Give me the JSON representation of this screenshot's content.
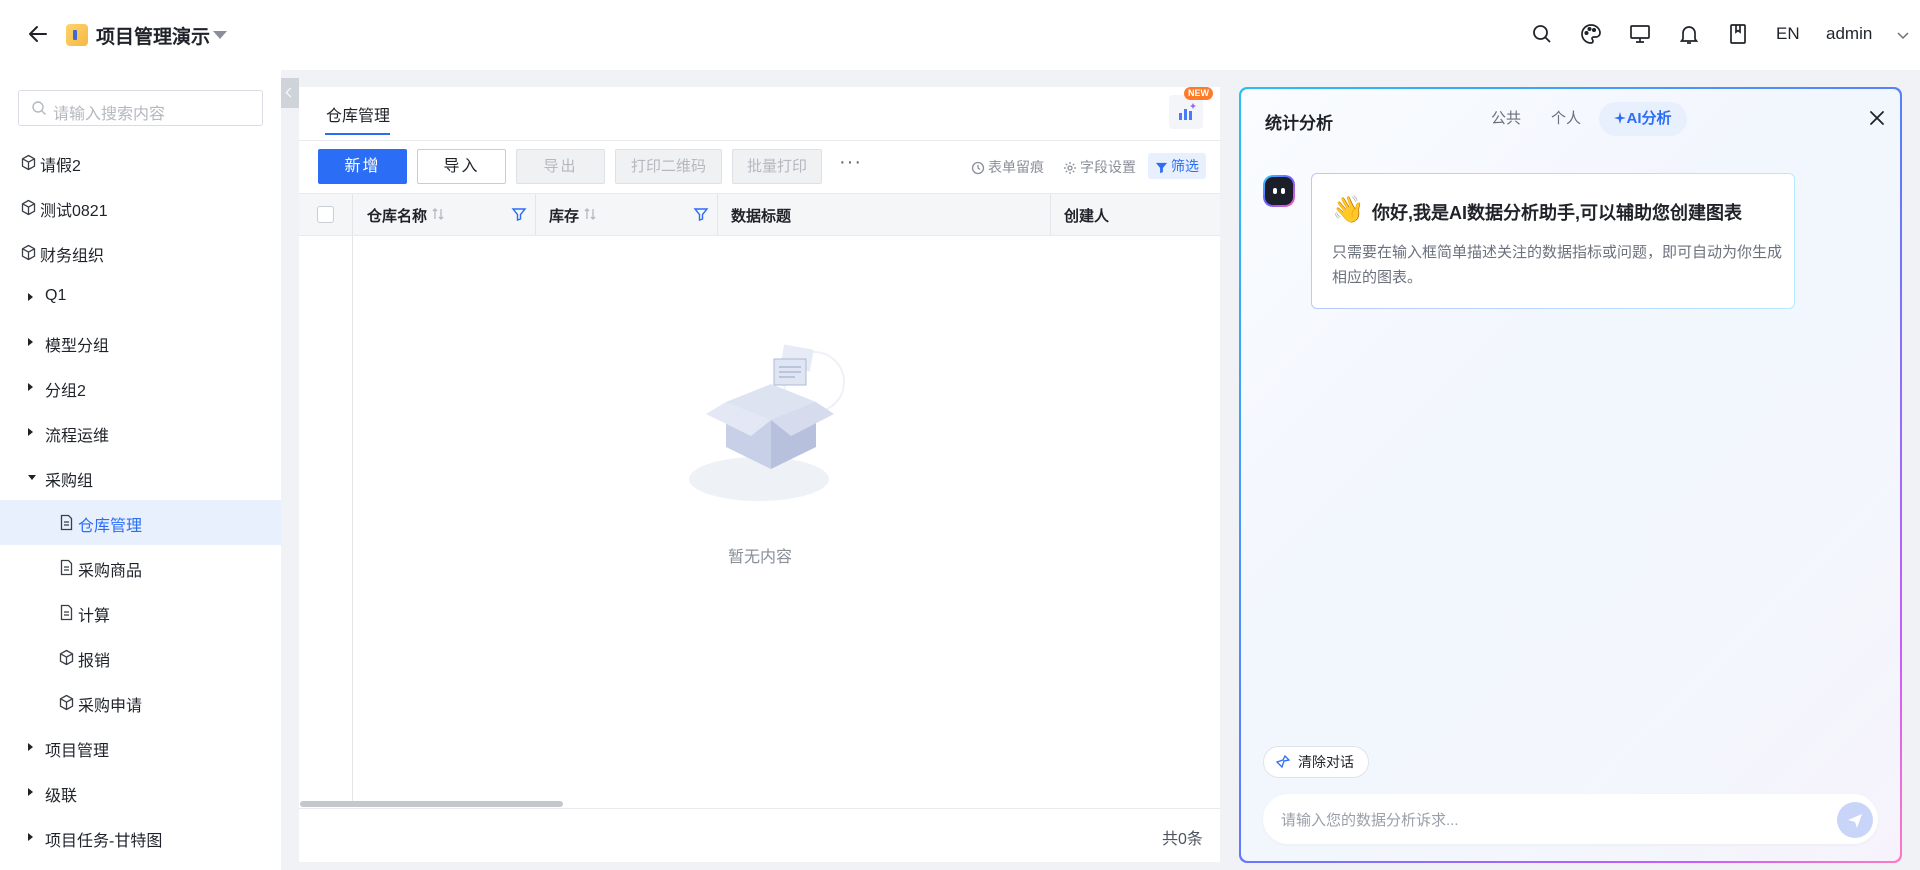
{
  "header": {
    "app_title": "项目管理演示",
    "lang": "EN",
    "user": "admin"
  },
  "sidebar": {
    "search_placeholder": "请输入搜索内容",
    "items": [
      {
        "label": "请假2",
        "icon": "cube-icon",
        "level": 0
      },
      {
        "label": "测试0821",
        "icon": "cube-icon",
        "level": 0
      },
      {
        "label": "财务组织",
        "icon": "cube-icon",
        "level": 0
      },
      {
        "label": "Q1",
        "icon": "caret-right-icon",
        "level": 0
      },
      {
        "label": "模型分组",
        "icon": "caret-right-icon",
        "level": 0
      },
      {
        "label": "分组2",
        "icon": "caret-right-icon",
        "level": 0
      },
      {
        "label": "流程运维",
        "icon": "caret-right-icon",
        "level": 0
      },
      {
        "label": "采购组",
        "icon": "caret-down-icon",
        "level": 0
      },
      {
        "label": "仓库管理",
        "icon": "document-icon",
        "level": 1,
        "active": true
      },
      {
        "label": "采购商品",
        "icon": "document-icon",
        "level": 1
      },
      {
        "label": "计算",
        "icon": "document-icon",
        "level": 1
      },
      {
        "label": "报销",
        "icon": "cube-icon",
        "level": 1
      },
      {
        "label": "采购申请",
        "icon": "cube-icon",
        "level": 1
      },
      {
        "label": "项目管理",
        "icon": "caret-right-icon",
        "level": 0
      },
      {
        "label": "级联",
        "icon": "caret-right-icon",
        "level": 0
      },
      {
        "label": "项目任务-甘特图",
        "icon": "caret-right-icon",
        "level": 0
      }
    ]
  },
  "main": {
    "tab_title": "仓库管理",
    "new_badge": "NEW",
    "buttons": {
      "add": "新增",
      "import": "导入",
      "export": "导出",
      "print_qr": "打印二维码",
      "batch_print": "批量打印",
      "more": "···"
    },
    "tools": {
      "form_trace": "表单留痕",
      "field_settings": "字段设置",
      "filter": "筛选"
    },
    "columns": [
      "仓库名称",
      "库存",
      "数据标题",
      "创建人"
    ],
    "empty_text": "暂无内容",
    "total": "共0条"
  },
  "ai_panel": {
    "title": "统计分析",
    "tabs": [
      "公共",
      "个人",
      "AI分析"
    ],
    "active_tab": "AI分析",
    "greeting_emoji": "👋",
    "greeting_title": "你好,我是AI数据分析助手,可以辅助您创建图表",
    "greeting_body": "只需要在输入框简单描述关注的数据指标或问题，即可自动为你生成相应的图表。",
    "clear_label": "清除对话",
    "input_placeholder": "请输入您的数据分析诉求..."
  },
  "colors": {
    "primary": "#2b6ef5",
    "active_bg": "#e8f0fe",
    "new_badge": "#ff7a29"
  }
}
